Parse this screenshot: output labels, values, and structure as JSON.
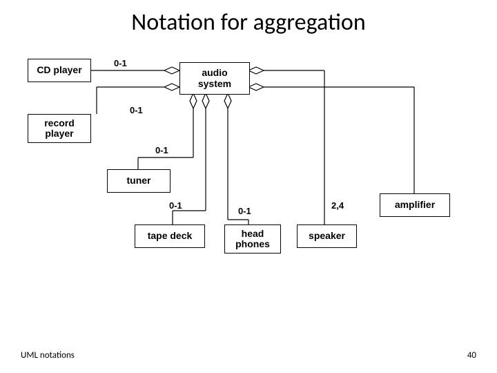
{
  "title": "Notation for aggregation",
  "footer": {
    "left": "UML notations",
    "right": "40"
  },
  "classes": {
    "cd_player": "CD player",
    "record_player": "record\nplayer",
    "audio_system": "audio\nsystem",
    "tuner": "tuner",
    "tape_deck": "tape deck",
    "head_phones": "head\nphones",
    "speaker": "speaker",
    "amplifier": "amplifier"
  },
  "multiplicities": {
    "cd": "0-1",
    "record": "0-1",
    "tuner": "0-1",
    "tape": "0-1",
    "head": "0-1",
    "speaker": "2,4"
  }
}
